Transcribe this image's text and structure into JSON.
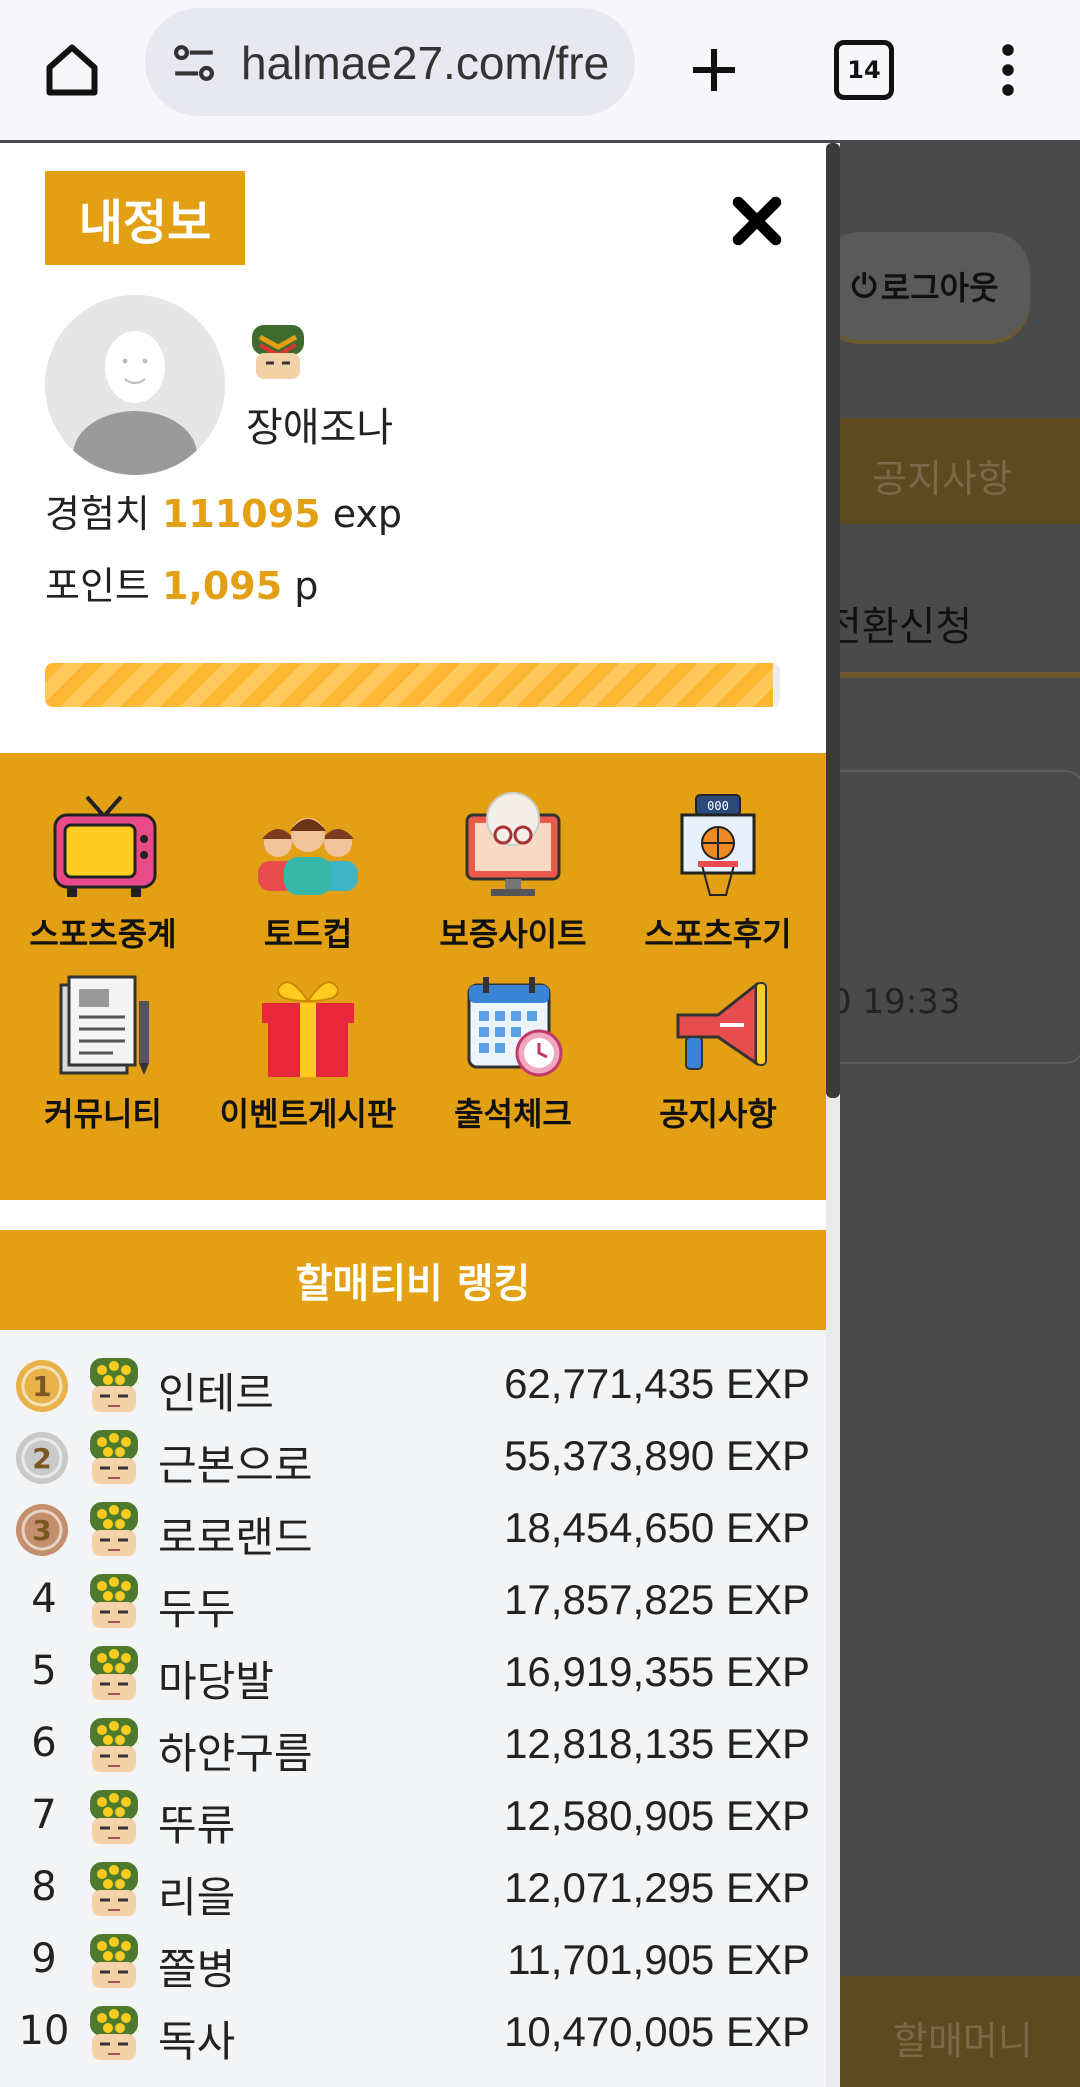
{
  "browser": {
    "url": "halmae27.com/fre",
    "tab_count": "14",
    "icons": [
      "home-icon",
      "site-settings-icon",
      "new-tab-icon",
      "tab-switcher-icon",
      "more-menu-icon"
    ]
  },
  "background_page": {
    "logout_label": "로그아웃",
    "notice_label": "공지사항",
    "convert_label": "전환신청",
    "timestamp": "0 19:33",
    "bottom_label": "할매머니"
  },
  "drawer": {
    "title": "내정보",
    "close_icon": "close-icon",
    "profile": {
      "nickname": "장애조나",
      "exp_label": "경험치",
      "exp_value": "111095",
      "exp_unit": "exp",
      "point_label": "포인트",
      "point_value": "1,095",
      "point_unit": "p",
      "progress": 0.99
    },
    "menu": [
      {
        "label": "스포츠중계",
        "icon": "tv-icon"
      },
      {
        "label": "토드컵",
        "icon": "people-icon"
      },
      {
        "label": "보증사이트",
        "icon": "monitor-grandma-icon"
      },
      {
        "label": "스포츠후기",
        "icon": "basketball-board-icon"
      },
      {
        "label": "커뮤니티",
        "icon": "document-pencil-icon"
      },
      {
        "label": "이벤트게시판",
        "icon": "gift-icon"
      },
      {
        "label": "출석체크",
        "icon": "calendar-clock-icon"
      },
      {
        "label": "공지사항",
        "icon": "megaphone-icon"
      }
    ],
    "ranking": {
      "title": "할매티비 랭킹",
      "rows": [
        {
          "rank": "1",
          "name": "인테르",
          "exp": "62,771,435 EXP"
        },
        {
          "rank": "2",
          "name": "근본으로",
          "exp": "55,373,890 EXP"
        },
        {
          "rank": "3",
          "name": "로로랜드",
          "exp": "18,454,650 EXP"
        },
        {
          "rank": "4",
          "name": "두두",
          "exp": "17,857,825 EXP"
        },
        {
          "rank": "5",
          "name": "마당발",
          "exp": "16,919,355 EXP"
        },
        {
          "rank": "6",
          "name": "하얀구름",
          "exp": "12,818,135 EXP"
        },
        {
          "rank": "7",
          "name": "뚜류",
          "exp": "12,580,905 EXP"
        },
        {
          "rank": "8",
          "name": "리을",
          "exp": "12,071,295 EXP"
        },
        {
          "rank": "9",
          "name": "쫄병",
          "exp": "11,701,905 EXP"
        },
        {
          "rank": "10",
          "name": "독사",
          "exp": "10,470,005 EXP"
        }
      ]
    }
  },
  "colors": {
    "accent": "#e3a014",
    "overlay": "#4a4a4a"
  }
}
